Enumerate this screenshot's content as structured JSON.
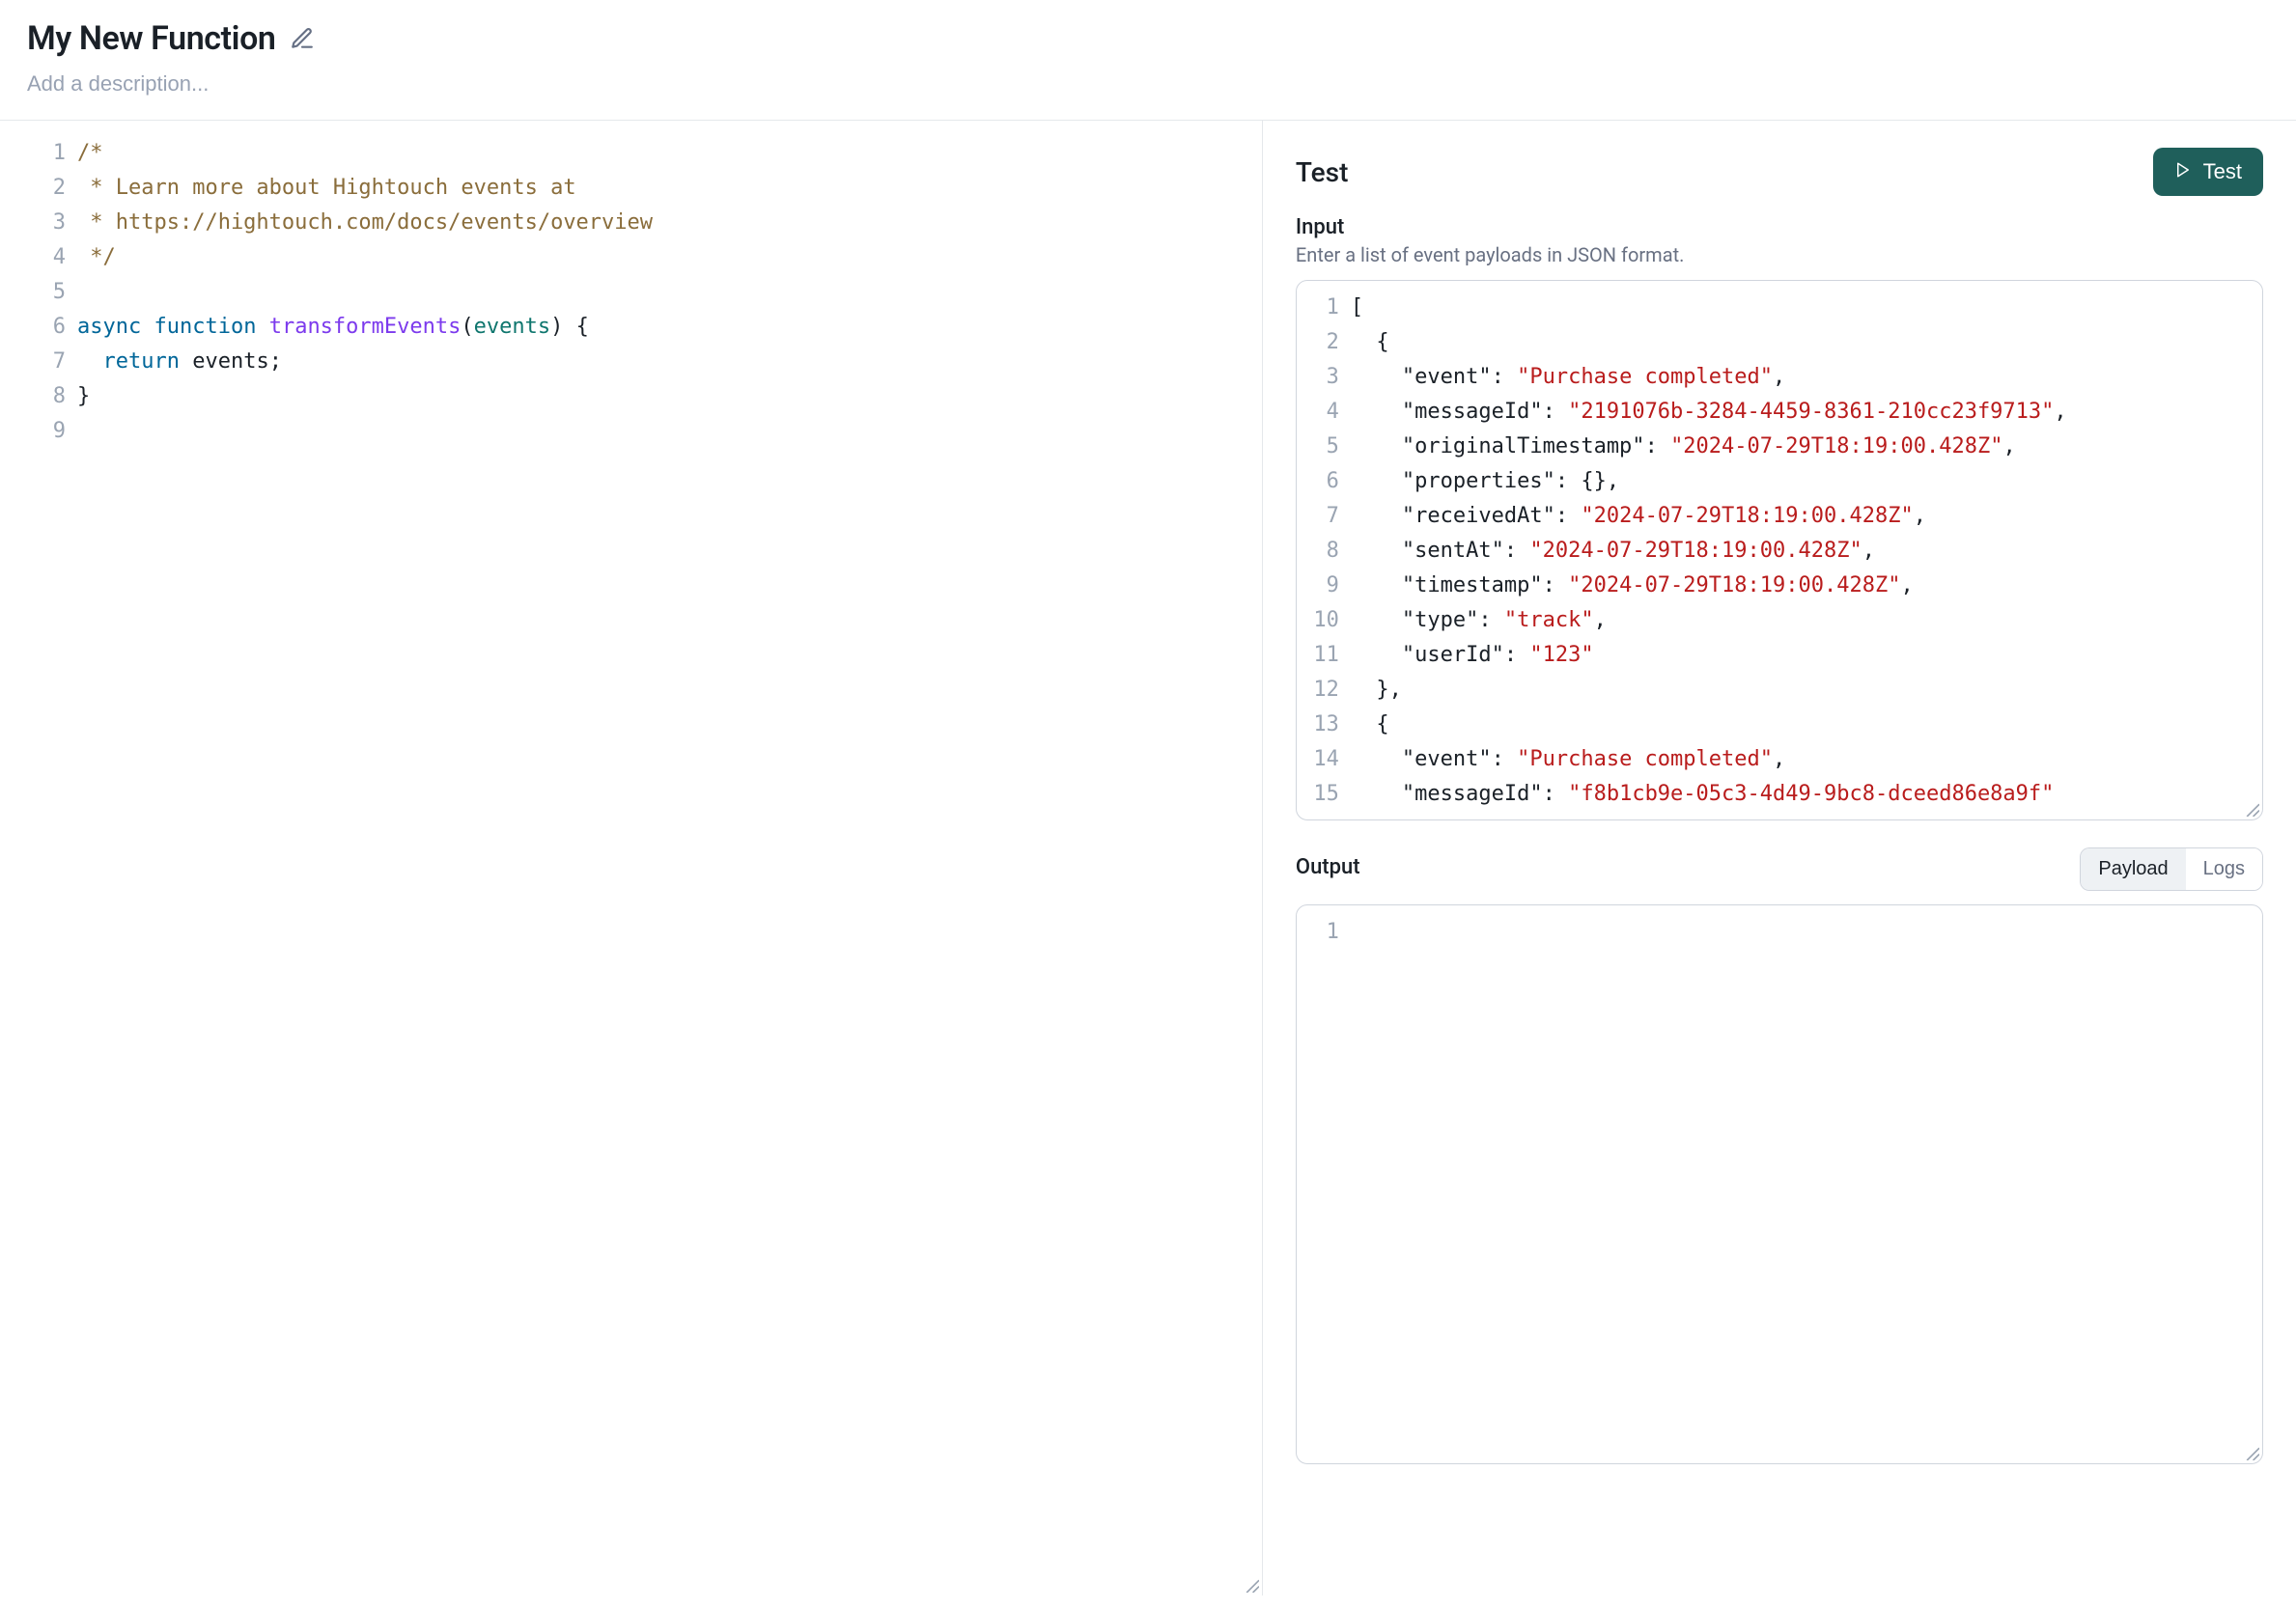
{
  "header": {
    "title": "My New Function",
    "description_value": "",
    "description_placeholder": "Add a description..."
  },
  "code_editor": {
    "lines": [
      [
        {
          "t": "comment",
          "v": "/*"
        }
      ],
      [
        {
          "t": "comment",
          "v": " * Learn more about Hightouch events at"
        }
      ],
      [
        {
          "t": "comment",
          "v": " * https://hightouch.com/docs/events/overview"
        }
      ],
      [
        {
          "t": "comment",
          "v": " */"
        }
      ],
      [
        {
          "t": "pn",
          "v": ""
        }
      ],
      [
        {
          "t": "kw",
          "v": "async"
        },
        {
          "t": "pn",
          "v": " "
        },
        {
          "t": "kw",
          "v": "function"
        },
        {
          "t": "pn",
          "v": " "
        },
        {
          "t": "fn",
          "v": "transformEvents"
        },
        {
          "t": "pn",
          "v": "("
        },
        {
          "t": "id",
          "v": "events"
        },
        {
          "t": "pn",
          "v": ") {"
        }
      ],
      [
        {
          "t": "pn",
          "v": "  "
        },
        {
          "t": "kw",
          "v": "return"
        },
        {
          "t": "pn",
          "v": " events;"
        }
      ],
      [
        {
          "t": "pn",
          "v": "}"
        }
      ],
      [
        {
          "t": "pn",
          "v": ""
        }
      ]
    ]
  },
  "test": {
    "section_title": "Test",
    "button_label": "Test",
    "input": {
      "label": "Input",
      "hint": "Enter a list of event payloads in JSON format.",
      "lines": [
        [
          {
            "t": "pn",
            "v": "["
          }
        ],
        [
          {
            "t": "pn",
            "v": "  {"
          }
        ],
        [
          {
            "t": "pn",
            "v": "    "
          },
          {
            "t": "key",
            "v": "\"event\""
          },
          {
            "t": "pn",
            "v": ": "
          },
          {
            "t": "str",
            "v": "\"Purchase completed\""
          },
          {
            "t": "pn",
            "v": ","
          }
        ],
        [
          {
            "t": "pn",
            "v": "    "
          },
          {
            "t": "key",
            "v": "\"messageId\""
          },
          {
            "t": "pn",
            "v": ": "
          },
          {
            "t": "str",
            "v": "\"2191076b-3284-4459-8361-210cc23f9713\""
          },
          {
            "t": "pn",
            "v": ","
          }
        ],
        [
          {
            "t": "pn",
            "v": "    "
          },
          {
            "t": "key",
            "v": "\"originalTimestamp\""
          },
          {
            "t": "pn",
            "v": ": "
          },
          {
            "t": "str",
            "v": "\"2024-07-29T18:19:00.428Z\""
          },
          {
            "t": "pn",
            "v": ","
          }
        ],
        [
          {
            "t": "pn",
            "v": "    "
          },
          {
            "t": "key",
            "v": "\"properties\""
          },
          {
            "t": "pn",
            "v": ": {},"
          }
        ],
        [
          {
            "t": "pn",
            "v": "    "
          },
          {
            "t": "key",
            "v": "\"receivedAt\""
          },
          {
            "t": "pn",
            "v": ": "
          },
          {
            "t": "str",
            "v": "\"2024-07-29T18:19:00.428Z\""
          },
          {
            "t": "pn",
            "v": ","
          }
        ],
        [
          {
            "t": "pn",
            "v": "    "
          },
          {
            "t": "key",
            "v": "\"sentAt\""
          },
          {
            "t": "pn",
            "v": ": "
          },
          {
            "t": "str",
            "v": "\"2024-07-29T18:19:00.428Z\""
          },
          {
            "t": "pn",
            "v": ","
          }
        ],
        [
          {
            "t": "pn",
            "v": "    "
          },
          {
            "t": "key",
            "v": "\"timestamp\""
          },
          {
            "t": "pn",
            "v": ": "
          },
          {
            "t": "str",
            "v": "\"2024-07-29T18:19:00.428Z\""
          },
          {
            "t": "pn",
            "v": ","
          }
        ],
        [
          {
            "t": "pn",
            "v": "    "
          },
          {
            "t": "key",
            "v": "\"type\""
          },
          {
            "t": "pn",
            "v": ": "
          },
          {
            "t": "str",
            "v": "\"track\""
          },
          {
            "t": "pn",
            "v": ","
          }
        ],
        [
          {
            "t": "pn",
            "v": "    "
          },
          {
            "t": "key",
            "v": "\"userId\""
          },
          {
            "t": "pn",
            "v": ": "
          },
          {
            "t": "str",
            "v": "\"123\""
          }
        ],
        [
          {
            "t": "pn",
            "v": "  },"
          }
        ],
        [
          {
            "t": "pn",
            "v": "  {"
          }
        ],
        [
          {
            "t": "pn",
            "v": "    "
          },
          {
            "t": "key",
            "v": "\"event\""
          },
          {
            "t": "pn",
            "v": ": "
          },
          {
            "t": "str",
            "v": "\"Purchase completed\""
          },
          {
            "t": "pn",
            "v": ","
          }
        ],
        [
          {
            "t": "pn",
            "v": "    "
          },
          {
            "t": "key",
            "v": "\"messageId\""
          },
          {
            "t": "pn",
            "v": ": "
          },
          {
            "t": "str",
            "v": "\"f8b1cb9e-05c3-4d49-9bc8-dceed86e8a9f\""
          }
        ]
      ]
    },
    "output": {
      "label": "Output",
      "tabs": {
        "payload": "Payload",
        "logs": "Logs",
        "active": "payload"
      },
      "lines": [
        [
          {
            "t": "pn",
            "v": ""
          }
        ]
      ]
    }
  }
}
